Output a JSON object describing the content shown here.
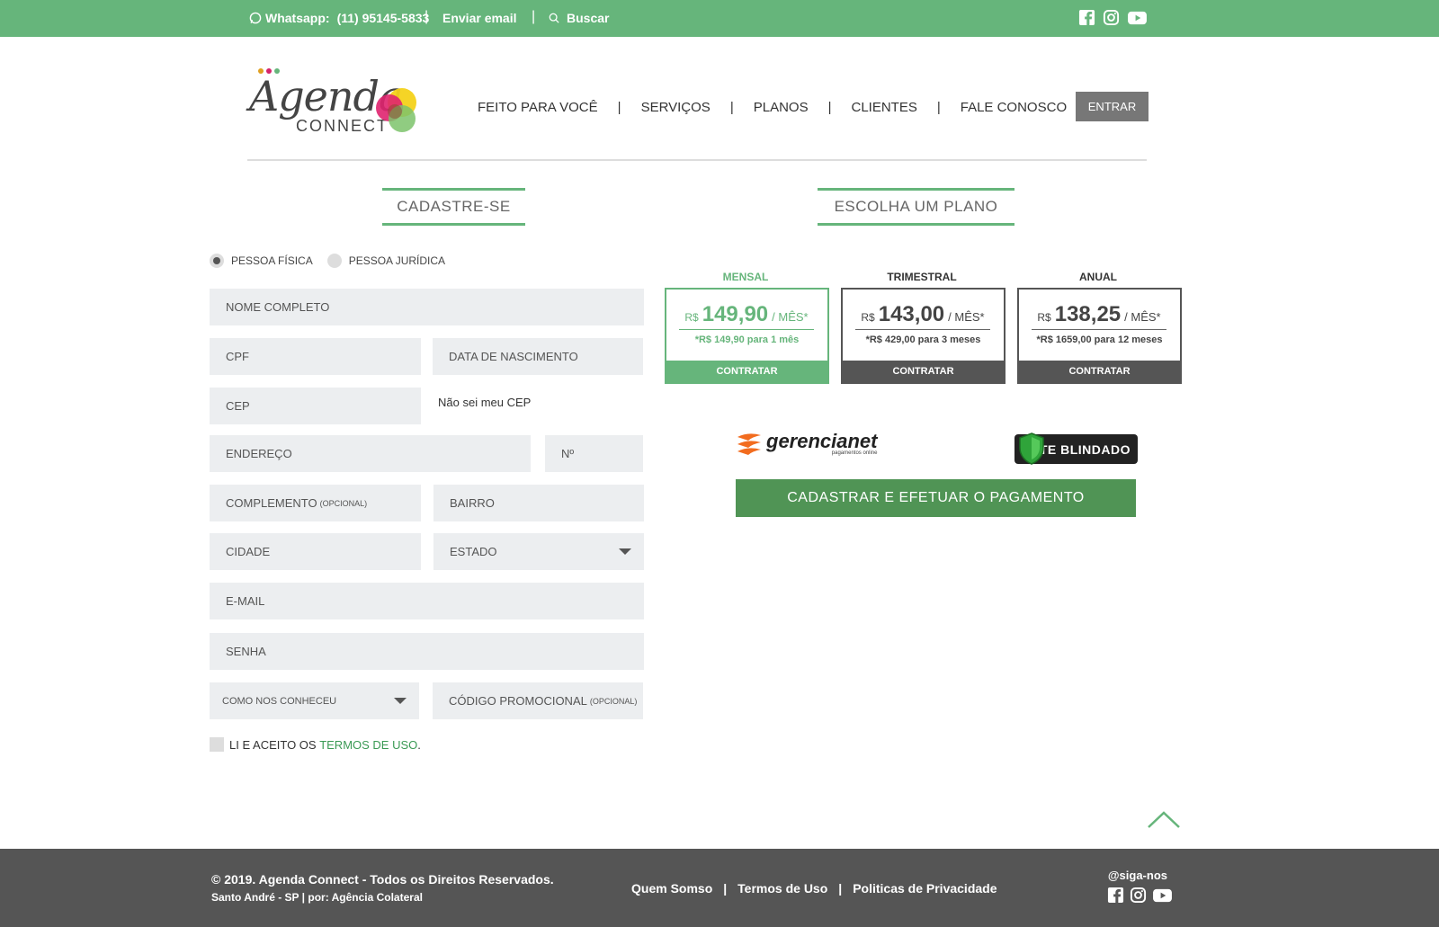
{
  "topbar": {
    "whatsapp_label": "Whatsapp:",
    "whatsapp_number": "(11) 95145-5833",
    "sep1": "|",
    "email_label": "Enviar email",
    "sep2": "|",
    "search_label": "Buscar",
    "social_icons": [
      "facebook-icon",
      "instagram-icon",
      "youtube-icon"
    ]
  },
  "header": {
    "logo_word": "Agenda",
    "logo_sub": "CONNECT",
    "nav": [
      "FEITO PARA VOCÊ",
      "SERVIÇOS",
      "PLANOS",
      "CLIENTES",
      "FALE CONOSCO"
    ],
    "nav_sep": "|",
    "login_label": "ENTRAR"
  },
  "signup": {
    "title": "CADASTRE-SE",
    "radio_fisica": "PESSOA FÍSICA",
    "radio_juridica": "PESSOA JURÍDICA",
    "nome": "NOME COMPLETO",
    "cpf": "CPF",
    "nascimento": "DATA DE NASCIMENTO",
    "cep": "CEP",
    "cep_help": "Não sei meu CEP",
    "endereco": "ENDEREÇO",
    "numero": "Nº",
    "complemento": "COMPLEMENTO",
    "complemento_opt": "(OPCIONAL)",
    "bairro": "BAIRRO",
    "cidade": "CIDADE",
    "estado": "ESTADO",
    "email": "E-MAIL",
    "senha": "SENHA",
    "como_conheceu": "COMO NOS CONHECEU",
    "codigo": "CÓDIGO PROMOCIONAL",
    "codigo_opt": "(OPCIONAL)",
    "terms_prefix": "LI E ACEITO OS ",
    "terms_link": "TERMOS DE USO",
    "terms_suffix": "."
  },
  "plans": {
    "title": "ESCOLHA UM PLANO",
    "items": [
      {
        "label": "MENSAL",
        "currency": "R$",
        "price": "149,90",
        "per": "/ MÊS*",
        "note": "*R$ 149,90 para 1 mês",
        "button": "CONTRATAR",
        "selected": true
      },
      {
        "label": "TRIMESTRAL",
        "currency": "R$",
        "price": "143,00",
        "per": "/ MÊS*",
        "note": "*R$ 429,00 para 3 meses",
        "button": "CONTRATAR",
        "selected": false
      },
      {
        "label": "ANUAL",
        "currency": "R$",
        "price": "138,25",
        "per": "/ MÊS*",
        "note": "*R$ 1659,00 para 12 meses",
        "button": "CONTRATAR",
        "selected": false
      }
    ],
    "gerencianet": "gerencianet",
    "gerencianet_tag": "pagamentos online",
    "site_blindado": "SITE BLINDADO",
    "pay_button": "CADASTRAR E EFETUAR O PAGAMENTO"
  },
  "footer": {
    "copyright": "© 2019. Agenda Connect - Todos os Direitos Reservados.",
    "credit": "Santo André - SP | por: Agência Colateral",
    "links": [
      "Quem Somso",
      "Termos de Uso",
      "Politicas de Privacidade"
    ],
    "link_sep": "|",
    "follow": "@siga-nos"
  },
  "colors": {
    "brand_green": "#66b57b",
    "button_green": "#509455",
    "dark_gray": "#555555"
  }
}
